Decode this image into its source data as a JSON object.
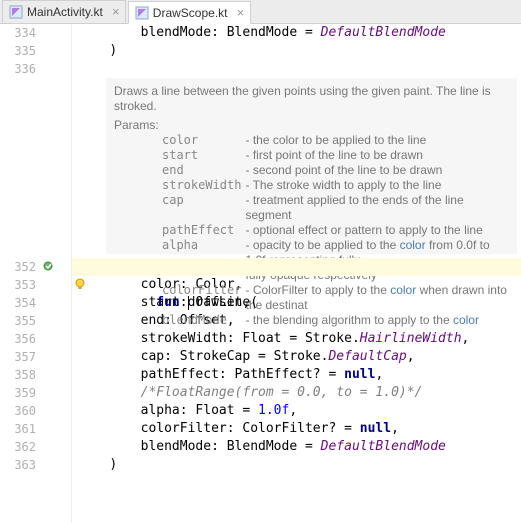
{
  "tabs": [
    {
      "label": "MainActivity.kt",
      "active": false
    },
    {
      "label": "DrawScope.kt",
      "active": true
    }
  ],
  "gutter": {
    "lines_top": [
      "334",
      "335",
      "336"
    ],
    "lines_bottom": [
      "352",
      "353",
      "354",
      "355",
      "356",
      "357",
      "358",
      "359",
      "360",
      "361",
      "362",
      "363"
    ]
  },
  "code_top": {
    "l334": {
      "indent": "        ",
      "t1": "blendMode: BlendMode = ",
      "mem": "DefaultBlendMode"
    },
    "l335": {
      "indent": "    ",
      "t1": ")"
    },
    "l336": {
      "indent": "",
      "t1": ""
    }
  },
  "doc": {
    "summary": "Draws a line between the given points using the given paint. The line is stroked.",
    "params_label": "Params:",
    "params": [
      {
        "name": "color",
        "desc_pre": " - the color to be applied to the line"
      },
      {
        "name": "start",
        "desc_pre": " - first point of the line to be drawn"
      },
      {
        "name": "end",
        "desc_pre": " - second point of the line to be drawn"
      },
      {
        "name": "strokeWidth",
        "desc_pre": " - The stroke width to apply to the line"
      },
      {
        "name": "cap",
        "desc_pre": " - treatment applied to the ends of the line segment"
      },
      {
        "name": "pathEffect",
        "desc_pre": " - optional effect or pattern to apply to the line"
      },
      {
        "name": "alpha",
        "desc_pre": " - opacity to be applied to the ",
        "link": "color",
        "desc_post": " from 0.0f to 1.0f representing fully"
      },
      {
        "name": "",
        "desc_pre": "fully opaque respectively"
      },
      {
        "name": "colorFilter",
        "desc_pre": " - ColorFilter to apply to the ",
        "link": "color",
        "desc_post": " when drawn into the destinat"
      },
      {
        "name": "blendMode",
        "desc_pre": " - the blending algorithm to apply to the ",
        "link": "color",
        "desc_post": ""
      }
    ]
  },
  "code_bottom": {
    "l352": {
      "kw": "fun ",
      "name": "drawLine(",
      "highlight": true
    },
    "l353": {
      "indent": "        ",
      "txt": "color: Color,"
    },
    "l354": {
      "indent": "        ",
      "txt": "start: Offset,"
    },
    "l355": {
      "indent": "        ",
      "txt": "end: Offset,"
    },
    "l356": {
      "indent": "        ",
      "t1": "strokeWidth: Float = Stroke.",
      "mem": "HairlineWidth",
      "t2": ","
    },
    "l357": {
      "indent": "        ",
      "t1": "cap: StrokeCap = Stroke.",
      "mem": "DefaultCap",
      "t2": ","
    },
    "l358": {
      "indent": "        ",
      "t1": "pathEffect: PathEffect? = ",
      "nul": "null",
      "t2": ","
    },
    "l359": {
      "indent": "        ",
      "com": "/*FloatRange(from = 0.0, to = 1.0)*/"
    },
    "l360": {
      "indent": "        ",
      "t1": "alpha: Float = ",
      "num": "1.0f",
      "t2": ","
    },
    "l361": {
      "indent": "        ",
      "t1": "colorFilter: ColorFilter? = ",
      "nul": "null",
      "t2": ","
    },
    "l362": {
      "indent": "        ",
      "t1": "blendMode: BlendMode = ",
      "mem": "DefaultBlendMode"
    },
    "l363": {
      "indent": "    ",
      "txt": ")"
    }
  },
  "icons": {
    "impl_marker": "impl",
    "intention_bulb": "bulb"
  }
}
